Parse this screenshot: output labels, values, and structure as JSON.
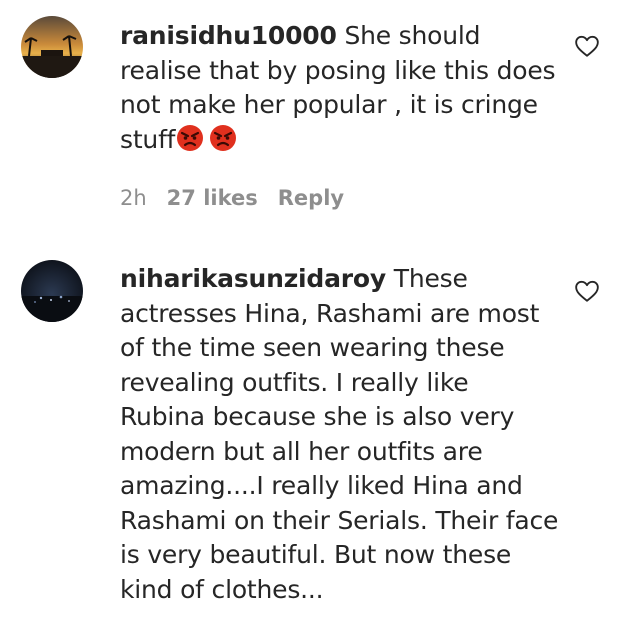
{
  "comments": [
    {
      "username": "ranisidhu10000",
      "text": "She should realise that by posing like this does not make her popular , it is cringe stuff",
      "emojis": [
        "angry-face",
        "angry-face"
      ],
      "time": "2h",
      "likes": "27 likes",
      "reply_label": "Reply",
      "liked": false
    },
    {
      "username": "niharikasunzidaroy",
      "text": "These actresses Hina, Rashami are most of the time seen wearing these revealing outfits. I really like Rubina because she is also very modern but all her outfits are amazing....I really liked Hina and Rashami on their Serials. Their face is very beautiful. But now these kind of clothes...",
      "liked": false
    }
  ],
  "colors": {
    "text": "#262626",
    "meta": "#8e8e8e",
    "emoji": "#e0301e"
  },
  "icons": {
    "like": "heart-outline-icon",
    "reaction": "angry-face-icon"
  }
}
